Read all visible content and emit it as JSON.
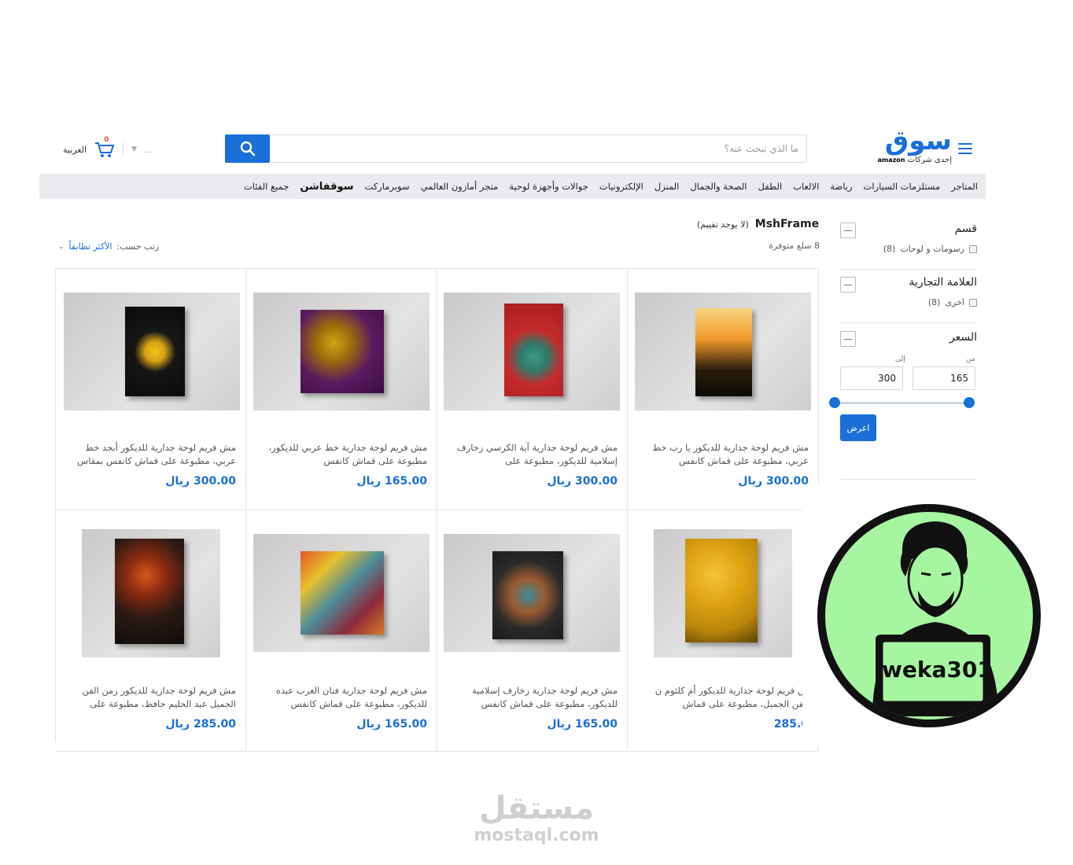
{
  "header": {
    "logo_text": "سوق",
    "logo_sub_prefix": "إحدى شركات",
    "logo_sub_brand": "amazon",
    "search_placeholder": "ما الذي تبحث عنه؟",
    "language_label": "العربية",
    "cart_count": "0",
    "more_label": "..."
  },
  "nav": {
    "items": [
      "جميع الفئات",
      "سوقفاشن",
      "سوبرماركت",
      "متجر أمازون العالمي",
      "جوالات وأجهزة لوحية",
      "الإلكترونيات",
      "المنزل",
      "الصحة والجمال",
      "الطفل",
      "الالعاب",
      "رياضة",
      "مستلزمات السيارات",
      "المتاجر"
    ]
  },
  "sidebar": {
    "category_title": "قسم",
    "category_option": "رسومات و لوحات",
    "category_count": "(8)",
    "brand_title": "العلامة التجارية",
    "brand_option": "اخرى",
    "brand_count": "(8)",
    "price_title": "السعر",
    "price_from_label": "من",
    "price_to_label": "إلى",
    "price_min": "165",
    "price_max": "300",
    "apply_label": "اعرض"
  },
  "store": {
    "name": "MshFrame",
    "rating": "(لا يوجد تقييم)",
    "count": "8 سلع متوفرة",
    "sort_label": "رتب حسب:",
    "sort_value": "الأكثر تطابقاً"
  },
  "products": [
    {
      "title": "مش فريم لوحة جدارية للديكور يا رب خط عربي، مطبوعة على قماش كانفس",
      "price": "300.00 ريال"
    },
    {
      "title": "مش فريم لوحة جدارية آية الكرسي زخارف إسلامية للديكور، مطبوعة على",
      "price": "300.00 ريال"
    },
    {
      "title": "مش فريم لوحة جدارية خط عربي للديكور، مطبوعة على قماش كانفس",
      "price": "165.00 ريال"
    },
    {
      "title": "مش فريم لوحة جدارية للديكور أبجد خط عربي، مطبوعة على قماش كانفس بمقاس",
      "price": "300.00 ريال"
    },
    {
      "title": "ش فريم لوحة جدارية للديكور أم كلثوم ن الفن الجميل، مطبوعة على قماش",
      "price": "285.0"
    },
    {
      "title": "مش فريم لوحة جدارية زخارف إسلامية للديكور، مطبوعة على قماش كانفس",
      "price": "165.00 ريال"
    },
    {
      "title": "مش فريم لوحة جدارية فنان العرب عبده للديكور، مطبوعة على قماش كانفس",
      "price": "165.00 ريال"
    },
    {
      "title": "مش فريم لوحة جدارية للديكور زمن الفن الجميل عبد الحليم حافظ، مطبوعة على",
      "price": "285.00 ريال"
    }
  ],
  "badge": {
    "text": "weka301",
    "bg_color": "#a6f5a0"
  },
  "watermark": {
    "arabic": "مستقل",
    "latin": "mostaql.com"
  },
  "colors": {
    "accent": "#1a6fd8"
  }
}
